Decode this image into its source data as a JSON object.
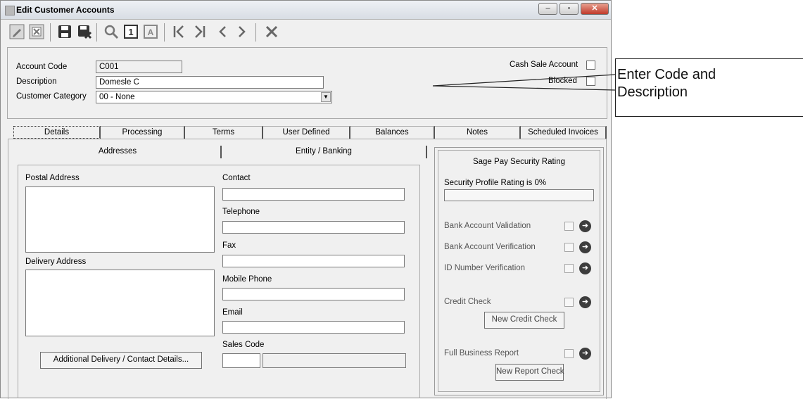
{
  "window": {
    "title": "Edit Customer Accounts",
    "controls": {
      "minimize": "–",
      "maximize": "▫",
      "close": "✕"
    }
  },
  "toolbar": {
    "icons": [
      "edit-icon",
      "cancel-edit-icon",
      "save-icon",
      "save-close-icon",
      "search-icon",
      "record-one-icon",
      "record-all-icon",
      "first-record-icon",
      "last-record-icon",
      "previous-record-icon",
      "next-record-icon",
      "delete-icon"
    ]
  },
  "header": {
    "account_code_label": "Account Code",
    "account_code_value": "C001",
    "description_label": "Description",
    "description_value": "Domesle C",
    "category_label": "Customer Category",
    "category_value": "00 - None",
    "cash_sale_label": "Cash Sale Account",
    "blocked_label": "Blocked"
  },
  "tabs": [
    "Details",
    "Processing",
    "Terms",
    "User Defined",
    "Balances",
    "Notes",
    "Scheduled Invoices"
  ],
  "subtabs": [
    "Addresses",
    "Entity / Banking"
  ],
  "addresses": {
    "postal_label": "Postal Address",
    "delivery_label": "Delivery Address",
    "contact_label": "Contact",
    "telephone_label": "Telephone",
    "fax_label": "Fax",
    "mobile_label": "Mobile Phone",
    "email_label": "Email",
    "sales_code_label": "Sales Code",
    "additional_button": "Additional Delivery / Contact Details..."
  },
  "sagepay": {
    "title": "Sage Pay Security Rating",
    "profile_rating": "Security Profile Rating is 0%",
    "profile_rating_fraction": 0,
    "bank_validation": "Bank Account Validation",
    "bank_verification": "Bank Account Verification",
    "id_verification": "ID Number Verification",
    "credit_check": "Credit Check",
    "new_credit_check": "New Credit Check",
    "full_report": "Full Business Report",
    "new_report_check": "New Report Check"
  },
  "callout": {
    "line1": "Enter Code and",
    "line2": "Description"
  }
}
